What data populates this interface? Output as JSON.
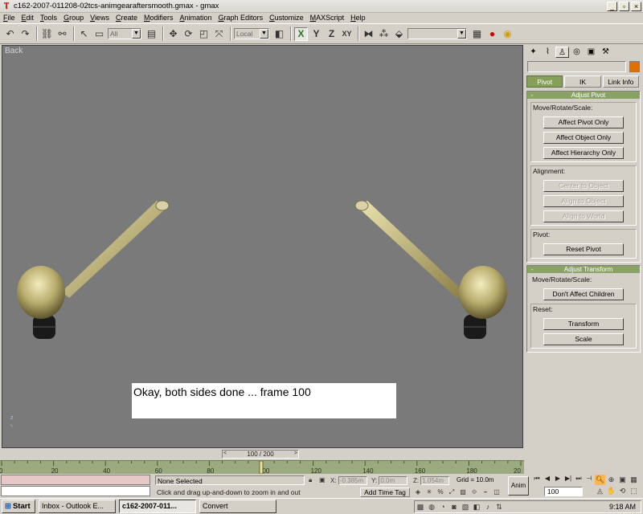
{
  "window": {
    "title": "c162-2007-011208-02tcs-animgearaftersmooth.gmax - gmax",
    "app_icon": "gmax-icon",
    "controls": [
      "_",
      "▫",
      "×"
    ]
  },
  "menu": [
    "File",
    "Edit",
    "Tools",
    "Group",
    "Views",
    "Create",
    "Modifiers",
    "Animation",
    "Graph Editors",
    "Customize",
    "MAXScript",
    "Help"
  ],
  "toolbar": {
    "selection_filter": "All",
    "coord_system": "Local",
    "axis_x": "X",
    "axis_y": "Y",
    "axis_z": "Z",
    "axis_xy": "XY",
    "named_selection": ""
  },
  "viewport": {
    "label": "Back",
    "caption": "Okay, both sides done ... frame 100",
    "axis_label": "z",
    "background": "#7a7a7a"
  },
  "command_panel": {
    "tabs": [
      "create",
      "modify",
      "hierarchy",
      "motion",
      "display",
      "utilities"
    ],
    "active_tab": "hierarchy",
    "object_color": "#e07000",
    "subtabs": [
      "Pivot",
      "IK",
      "Link Info"
    ],
    "active_subtab": "Pivot",
    "adjust_pivot": {
      "title": "Adjust Pivot",
      "move_group_label": "Move/Rotate/Scale:",
      "affect_pivot_only": "Affect Pivot Only",
      "affect_object_only": "Affect Object Only",
      "affect_hierarchy_only": "Affect Hierarchy Only",
      "alignment_label": "Alignment:",
      "center_to_object": "Center to Object",
      "align_to_object": "Align to Object",
      "align_to_world": "Align to World",
      "pivot_label": "Pivot:",
      "reset_pivot": "Reset Pivot"
    },
    "adjust_transform": {
      "title": "Adjust Transform",
      "move_group_label": "Move/Rotate/Scale:",
      "dont_affect_children": "Don't Affect Children",
      "reset_label": "Reset:",
      "transform": "Transform",
      "scale": "Scale"
    }
  },
  "timeslider": {
    "current": 100,
    "total": 200,
    "label": "100 / 200",
    "ticks": [
      "0",
      "20",
      "40",
      "60",
      "80",
      "100",
      "120",
      "140",
      "160",
      "180",
      "20"
    ]
  },
  "status": {
    "selection": "None Selected",
    "prompt": "Click and drag up-and-down to zoom in and out",
    "x_label": "X:",
    "x_value": "-0.385m",
    "y_label": "Y:",
    "y_value": "0.0m",
    "z_label": "Z:",
    "z_value": "1.054m",
    "grid": "Grid = 10.0m",
    "add_time_tag": "Add Time Tag",
    "anim_button": "Anim",
    "frame_value": "100"
  },
  "taskbar": {
    "start": "Start",
    "tasks": [
      {
        "label": "Inbox - Outlook E...",
        "active": false
      },
      {
        "label": "c162-2007-011...",
        "active": true
      },
      {
        "label": "Convert",
        "active": false
      }
    ],
    "clock": "9:18 AM"
  }
}
